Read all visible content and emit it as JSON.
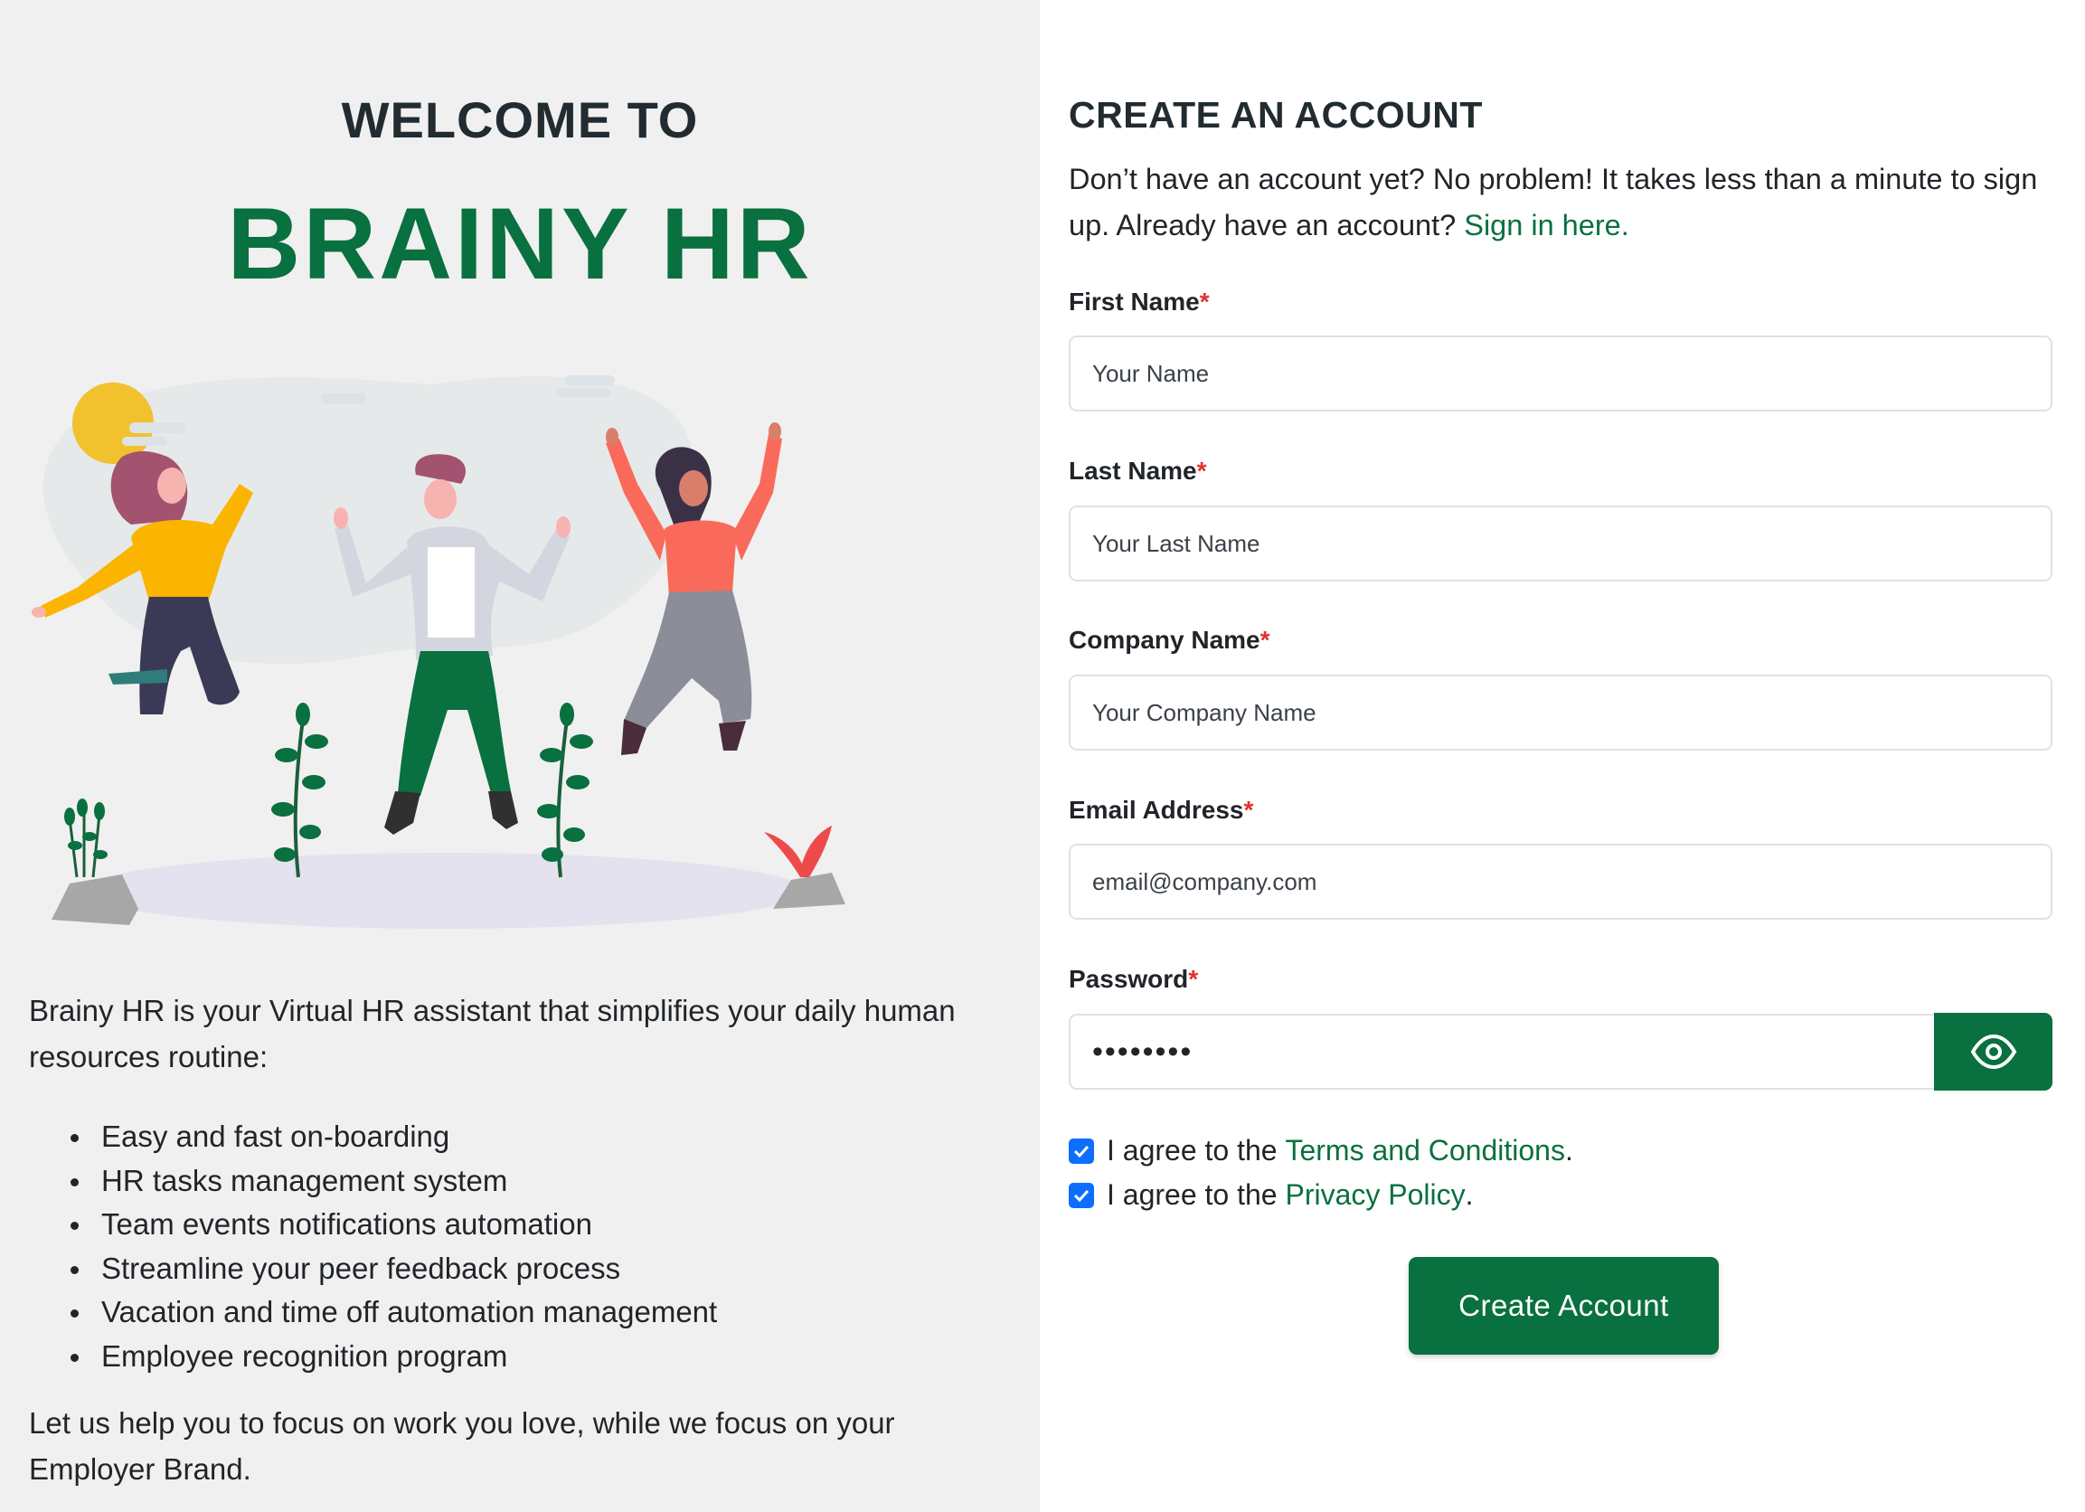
{
  "hero": {
    "welcome": "WELCOME TO",
    "brand": "BRAINY HR",
    "intro": "Brainy HR is your Virtual HR assistant that simplifies your daily human resources routine:",
    "features": [
      "Easy and fast on-boarding",
      "HR tasks management system",
      "Team events notifications automation",
      "Streamline your peer feedback process",
      "Vacation and time off automation management",
      "Employee recognition program"
    ],
    "outro": "Let us help you to focus on work you love, while we focus on your Employer Brand."
  },
  "form": {
    "title": "CREATE AN ACCOUNT",
    "subtitle": "Don’t have an account yet? No problem! It takes less than a minute to sign up. Already have an account?",
    "signin_link": "Sign in here.",
    "required_mark": "*",
    "fields": {
      "first_name": {
        "label": "First Name",
        "placeholder": "Your Name"
      },
      "last_name": {
        "label": "Last Name",
        "placeholder": "Your Last Name"
      },
      "company": {
        "label": "Company Name",
        "placeholder": "Your Company Name"
      },
      "email": {
        "label": "Email Address",
        "placeholder": "email@company.com"
      },
      "password": {
        "label": "Password",
        "value": "password"
      }
    },
    "show_password_icon": "eye-icon",
    "agreements": [
      {
        "prefix": "I agree to the",
        "link": "Terms and Conditions",
        "suffix": ".",
        "checked": true
      },
      {
        "prefix": "I agree to the",
        "link": "Privacy Policy",
        "suffix": ".",
        "checked": true
      }
    ],
    "submit_label": "Create Account"
  },
  "colors": {
    "brand_green": "#09703f",
    "left_bg": "#f0f0f0",
    "required_red": "#e03131",
    "checkbox_blue": "#0d6efd"
  }
}
